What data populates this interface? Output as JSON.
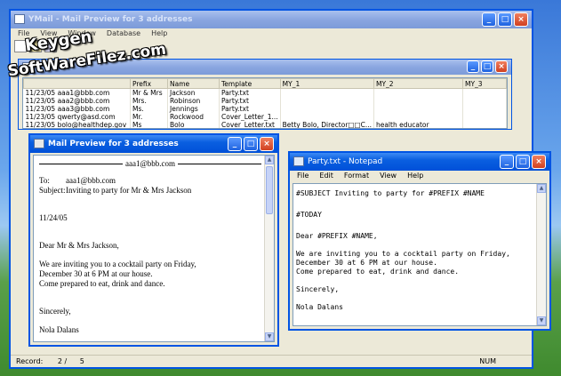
{
  "main_window": {
    "title": "YMail - Mail Preview for 3 addresses",
    "menu": [
      "File",
      "View",
      "Window",
      "Database",
      "Help"
    ],
    "status_record_label": "Record:",
    "status_record_value": "2 /",
    "status_record_total": "5",
    "status_num": "NUM"
  },
  "watermark": {
    "line1": "Keygen",
    "line2": "SoftWareFilez.com"
  },
  "grid": {
    "columns": [
      "",
      "Prefix",
      "Name",
      "Template",
      "MY_1",
      "MY_2",
      "MY_3"
    ],
    "rows": [
      [
        "11/23/05  aaa1@bbb.com",
        "Mr & Mrs",
        "Jackson",
        "Party.txt",
        "",
        "",
        ""
      ],
      [
        "11/23/05  aaa2@bbb.com",
        "Mrs.",
        "Robinson",
        "Party.txt",
        "",
        "",
        ""
      ],
      [
        "11/23/05  aaa3@bbb.com",
        "Ms.",
        "Jennings",
        "Party.txt",
        "",
        "",
        ""
      ],
      [
        "11/23/05  qwerty@asd.com",
        "Mr.",
        "Rockwood",
        "Cover_Letter_1...",
        "",
        "",
        ""
      ],
      [
        "11/23/05  bolo@healthdep.gov",
        "Ms",
        "Bolo",
        "Cover_Letter.txt",
        "Betty Bolo, Director□□C...",
        "health educator",
        ""
      ]
    ]
  },
  "preview": {
    "title": "Mail Preview for 3 addresses",
    "header_address": "aaa1@bbb.com",
    "to_label": "To:",
    "to_value": "aaa1@bbb.com",
    "subject_label": "Subject:",
    "subject_value": "Inviting to party for Mr & Mrs Jackson",
    "date": "11/24/05",
    "greeting": "Dear Mr & Mrs Jackson,",
    "body_line1": "We are inviting you to a cocktail party on Friday,",
    "body_line2": "December 30 at 6 PM at our house.",
    "body_line3": "Come prepared to eat, drink and dance.",
    "closing": "Sincerely,",
    "signature": "Nola Dalans"
  },
  "notepad": {
    "title": "Party.txt - Notepad",
    "menu": [
      "File",
      "Edit",
      "Format",
      "View",
      "Help"
    ],
    "line1": "#SUBJECT Inviting to party for #PREFIX #NAME",
    "line2": "#TODAY",
    "line3": "Dear #PREFIX #NAME,",
    "line4": "We are inviting you to a cocktail party on Friday,",
    "line5": "December 30 at 6 PM at our house.",
    "line6": "Come prepared to eat, drink and dance.",
    "line7": "Sincerely,",
    "line8": "Nola Dalans"
  }
}
